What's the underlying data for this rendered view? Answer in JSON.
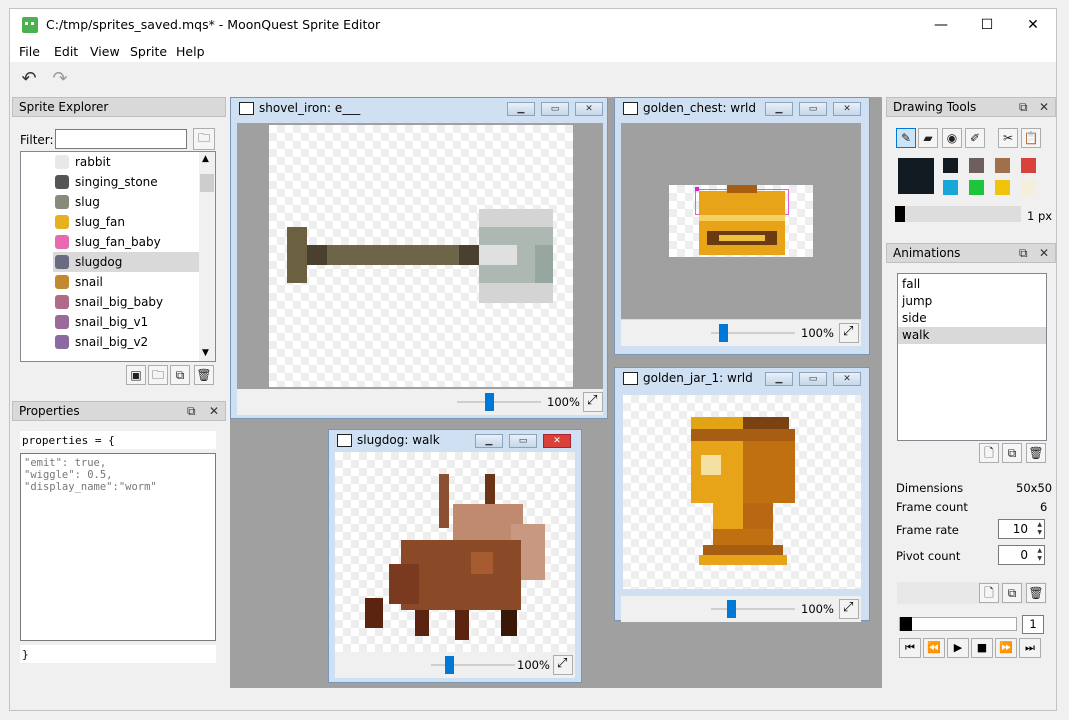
{
  "window": {
    "title": "C:/tmp/sprites_saved.mqs* - MoonQuest Sprite Editor",
    "min": "—",
    "max": "☐",
    "close": "✕"
  },
  "menu": [
    "File",
    "Edit",
    "View",
    "Sprite",
    "Help"
  ],
  "toolbar": {
    "undo": "↶",
    "redo": "↷"
  },
  "sprite_explorer": {
    "title": "Sprite Explorer",
    "filter_label": "Filter:",
    "filter_value": "",
    "items": [
      "rabbit",
      "singing_stone",
      "slug",
      "slug_fan",
      "slug_fan_baby",
      "slugdog",
      "snail",
      "snail_big_baby",
      "snail_big_v1",
      "snail_big_v2"
    ],
    "selected": "slugdog"
  },
  "properties": {
    "title": "Properties",
    "header": "properties = {",
    "body": "\"emit\": true,\n\"wiggle\": 0.5,\n\"display_name\":\"worm\"",
    "footer": "}"
  },
  "subwindows": {
    "shovel": {
      "title": "shovel_iron: e___",
      "zoom": "100%",
      "zoom_level": 0.45
    },
    "chest": {
      "title": "golden_chest: wrld",
      "zoom": "100%",
      "zoom_level": 0.15
    },
    "jar": {
      "title": "golden_jar_1: wrld",
      "zoom": "100%",
      "zoom_level": 0.15
    },
    "slugdog": {
      "title": "slugdog: walk",
      "zoom": "100%",
      "zoom_level": 0.2
    }
  },
  "drawing_tools": {
    "title": "Drawing Tools",
    "tools": [
      "pencil-icon",
      "eraser-icon",
      "eye-icon",
      "brush-icon",
      "scissors-icon",
      "paste-icon"
    ],
    "current_color": "#121a21",
    "palette": [
      "#121a21",
      "#6e5e5e",
      "#a0704c",
      "#d9423a",
      "#17a6d8",
      "#1ec43a",
      "#f0c40c",
      "#f4efdc"
    ],
    "brush_size": "1 px"
  },
  "animations": {
    "title": "Animations",
    "items": [
      "fall",
      "jump",
      "side",
      "walk"
    ],
    "selected": "walk",
    "dimensions_label": "Dimensions",
    "dimensions_value": "50x50",
    "frame_count_label": "Frame count",
    "frame_count_value": "6",
    "frame_rate_label": "Frame rate",
    "frame_rate_value": "10",
    "pivot_count_label": "Pivot count",
    "pivot_count_value": "0",
    "frame_index": "1"
  }
}
